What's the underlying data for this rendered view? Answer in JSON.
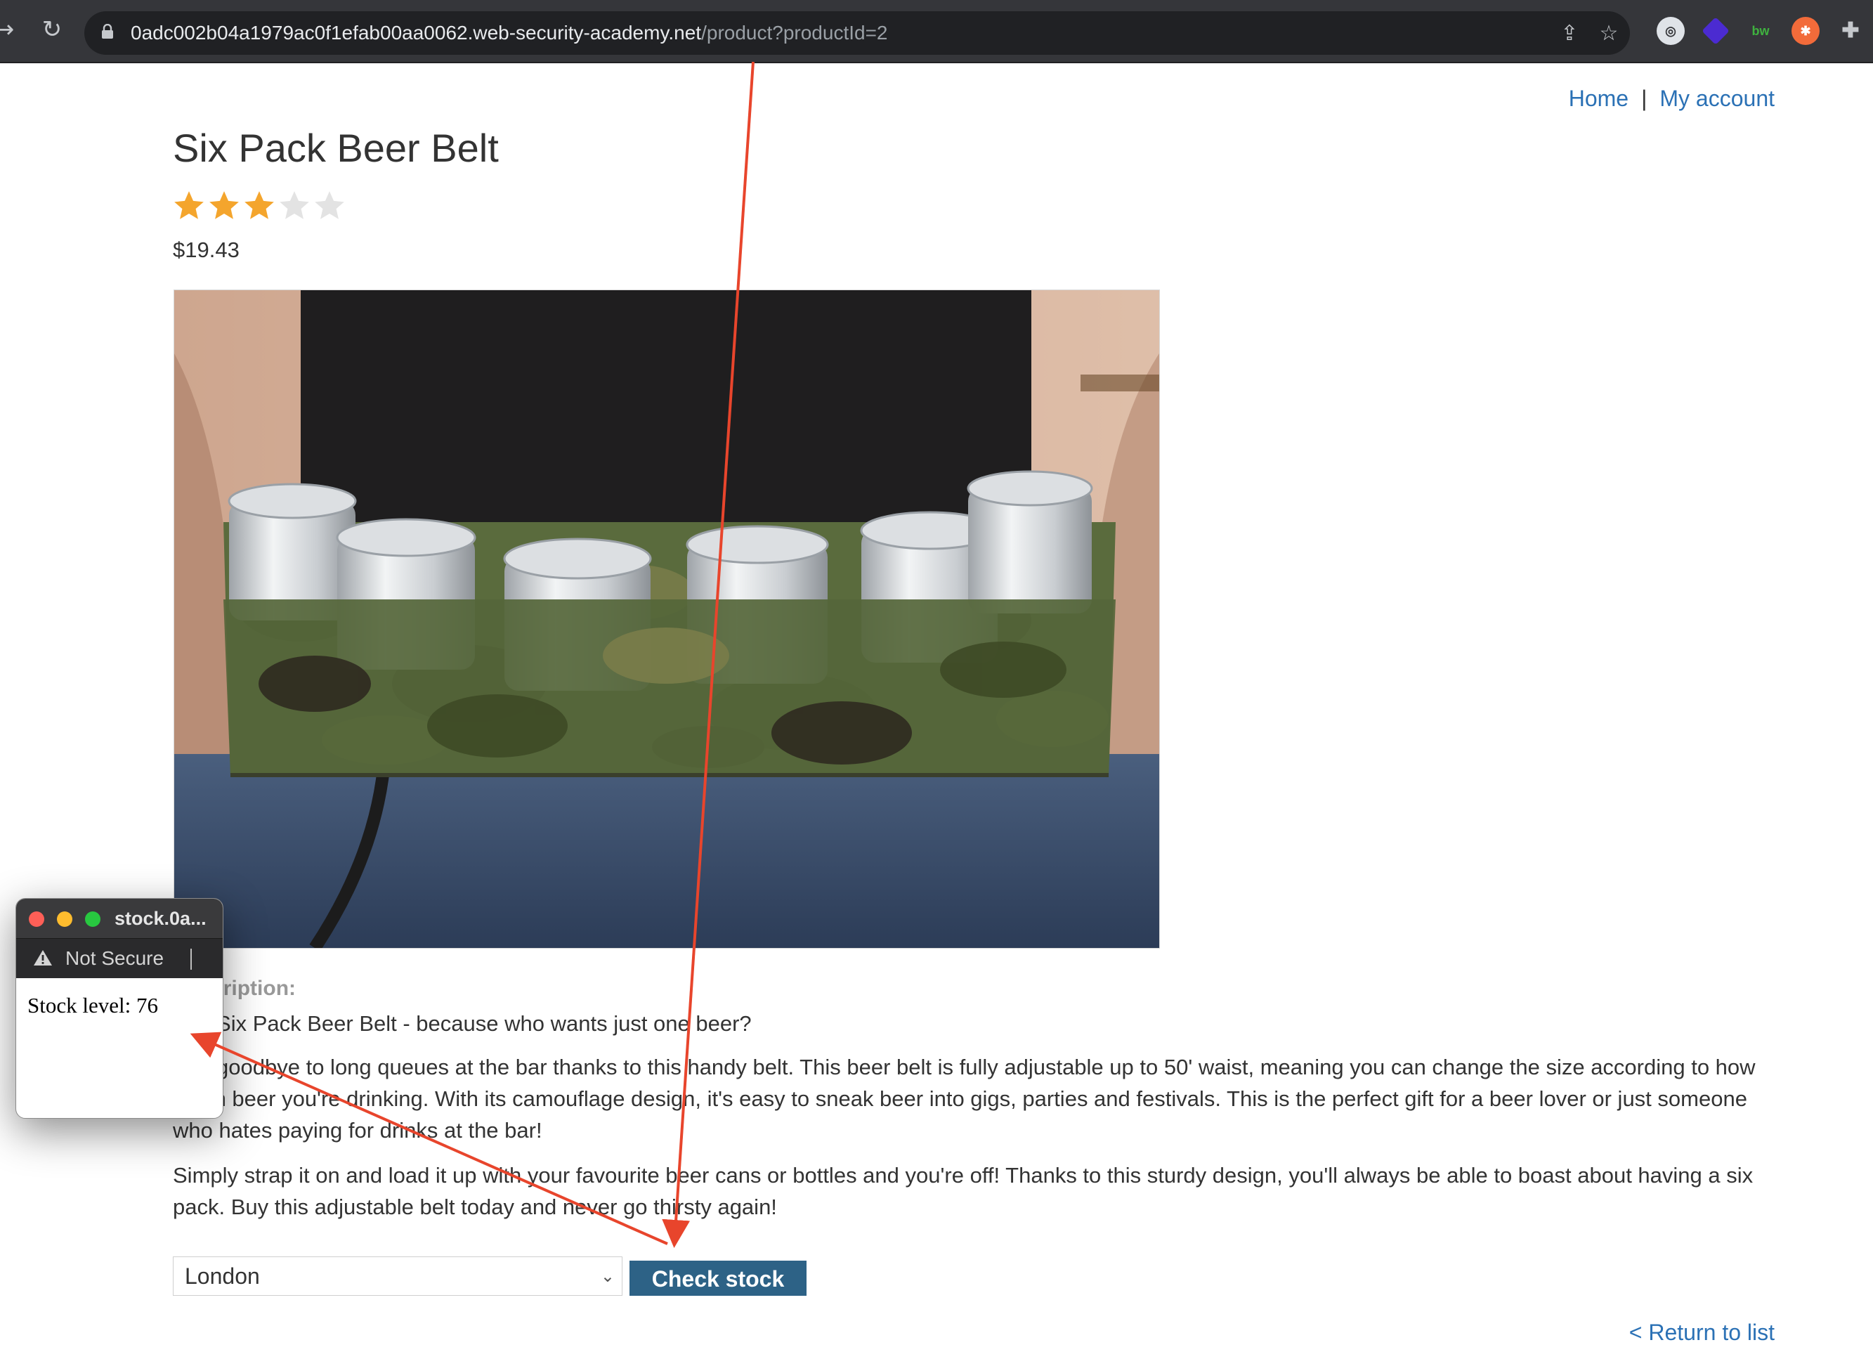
{
  "browser": {
    "url_host": "0adc002b04a1979ac0f1efab00aa0062.web-security-academy.net",
    "url_path": "/product?productId=2"
  },
  "nav": {
    "home": "Home",
    "separator": "|",
    "account": "My account"
  },
  "product": {
    "title": "Six Pack Beer Belt",
    "rating": 3,
    "rating_max": 5,
    "price": "$19.43",
    "description_heading": "Description:",
    "description": [
      "The Six Pack Beer Belt - because who wants just one beer?",
      "Say goodbye to long queues at the bar thanks to this handy belt. This beer belt is fully adjustable up to 50' waist, meaning you can change the size according to how much beer you're drinking. With its camouflage design, it's easy to sneak beer into gigs, parties and festivals. This is the perfect gift for a beer lover or just someone who hates paying for drinks at the bar!",
      "Simply strap it on and load it up with your favourite beer cans or bottles and you're off! Thanks to this sturdy design, you'll always be able to boast about having a six pack. Buy this adjustable belt today and never go thirsty again!"
    ]
  },
  "stock": {
    "selected_store": "London",
    "button_label": "Check stock",
    "return_link": "< Return to list"
  },
  "popup": {
    "title": "stock.0a...",
    "security_label": "Not Secure",
    "stock_text": "Stock level: 76"
  },
  "colors": {
    "link": "#2b71b5",
    "button": "#2d6286",
    "star_filled": "#f4a52d",
    "star_empty": "#e3e3e3",
    "annotation_arrow": "#e8452c"
  }
}
